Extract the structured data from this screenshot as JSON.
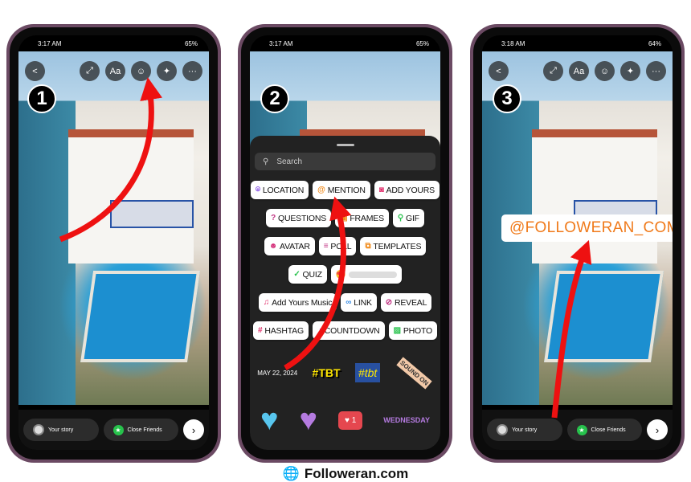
{
  "phones": [
    {
      "step": "1",
      "time": "3:17 AM",
      "battery": "65%",
      "bottom": {
        "your_story": "Your story",
        "close_friends": "Close Friends"
      }
    },
    {
      "step": "2",
      "time": "3:17 AM",
      "battery": "65%"
    },
    {
      "step": "3",
      "time": "3:18 AM",
      "battery": "64%",
      "bottom": {
        "your_story": "Your story",
        "close_friends": "Close Friends"
      },
      "mention_sticker": "@FOLLOWERAN_COM"
    }
  ],
  "top_controls": {
    "back": "<",
    "resize": "⤢",
    "text": "Aa",
    "sticker": "☺",
    "effects": "✦",
    "more": "···"
  },
  "sticker_panel": {
    "search_placeholder": "Search",
    "rows": [
      [
        {
          "label": "LOCATION",
          "icon": "location-pin",
          "color": "#7b3fe4"
        },
        {
          "label": "MENTION",
          "icon": "at-sign",
          "color": "#f08a1a"
        },
        {
          "label": "ADD YOURS",
          "icon": "camera",
          "color": "#e1306c"
        }
      ],
      [
        {
          "label": "QUESTIONS",
          "icon": "question",
          "color": "#c13584"
        },
        {
          "label": "FRAMES",
          "icon": "frame",
          "color": "#f08a1a"
        },
        {
          "label": "GIF",
          "icon": "search",
          "color": "#27c24c"
        }
      ],
      [
        {
          "label": "AVATAR",
          "icon": "avatar",
          "color": "#d4307a"
        },
        {
          "label": "POLL",
          "icon": "poll",
          "color": "#c13584"
        },
        {
          "label": "TEMPLATES",
          "icon": "templates",
          "color": "#f08a1a"
        }
      ],
      [
        {
          "label": "QUIZ",
          "icon": "check-circle",
          "color": "#27c24c"
        }
      ],
      [
        {
          "label": "Add Yours Music",
          "icon": "music",
          "color": "#e1306c"
        },
        {
          "label": "LINK",
          "icon": "link",
          "color": "#3a8ee6"
        },
        {
          "label": "REVEAL",
          "icon": "eye-off",
          "color": "#c13584"
        }
      ],
      [
        {
          "label": "HASHTAG",
          "icon": "hashtag",
          "color": "#e1306c"
        },
        {
          "label": "COUNTDOWN",
          "icon": "timer",
          "color": "#a13ad4"
        },
        {
          "label": "PHOTO",
          "icon": "image",
          "color": "#27c24c"
        }
      ]
    ],
    "emoji_slider": "😍",
    "date_sticker": "MAY 22, 2024",
    "tbt_sticker": "#TBT",
    "tbt2_sticker": "#tbt",
    "sound_sticker": "SOUND ON",
    "like_count": "1",
    "weekday_sticker": "WEDNESDAY"
  },
  "accent_colors": {
    "arrow": "#ee1111",
    "mention_text": "#f07a1a",
    "frame": "#6b4a63"
  },
  "footer": {
    "brand": "Followeran.com"
  }
}
